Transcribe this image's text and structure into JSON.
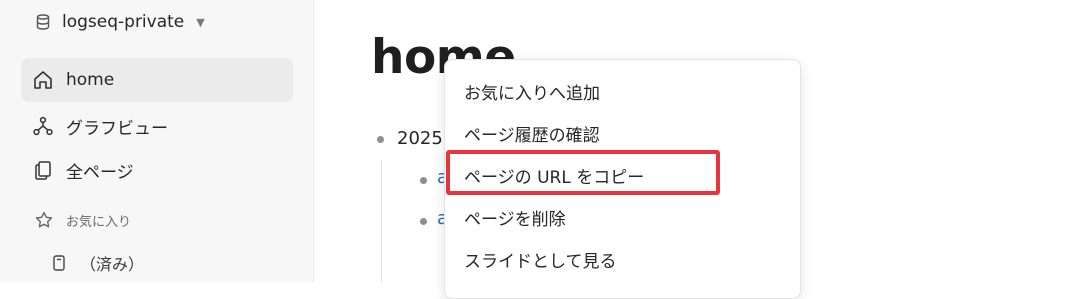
{
  "sidebar": {
    "graph_name": "logseq-private",
    "nav": [
      {
        "label": "home",
        "icon": "home-icon"
      },
      {
        "label": "グラフビュー",
        "icon": "graph-icon"
      },
      {
        "label": "全ページ",
        "icon": "pages-icon"
      }
    ],
    "favorites_label": "お気に入り",
    "favorites": [
      {
        "label": "（済み）",
        "icon": "page-icon"
      }
    ]
  },
  "main": {
    "title": "home",
    "block_text": "2025",
    "child_prefix": "a"
  },
  "context_menu": {
    "items": [
      "お気に入りへ追加",
      "ページ履歴の確認",
      "ページの URL をコピー",
      "ページを削除",
      "スライドとして見る"
    ],
    "highlighted_index": 2
  },
  "colors": {
    "highlight": "#e8343f",
    "link": "#2a6ab0",
    "sidebar_bg": "#f7f7f7"
  }
}
